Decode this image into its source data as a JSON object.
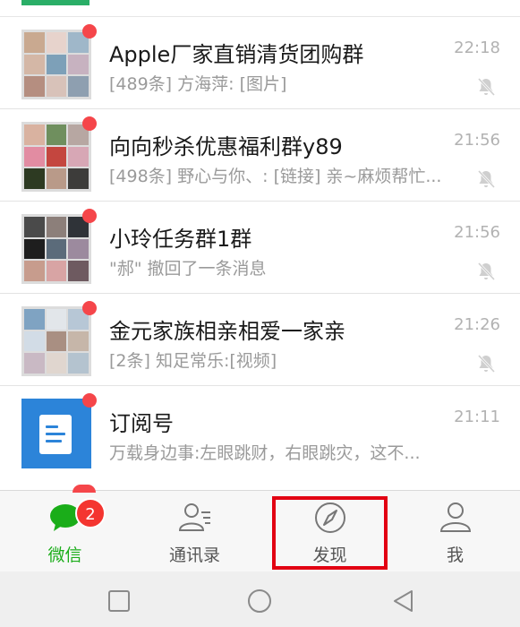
{
  "colors": {
    "accent_green": "#1aad19",
    "unread_red": "#f5464a",
    "badge_red": "#f43530",
    "highlight_red": "#e20012",
    "subscription_blue": "#2c84d9"
  },
  "chats": [
    {
      "name": "Apple厂家直销清货团购群",
      "preview": "[489条] 方海萍: [图片]",
      "time": "22:18",
      "avatar": "group-avatar",
      "muted": true,
      "unread_dot": true
    },
    {
      "name": "向向秒杀优惠福利群y89",
      "preview": "[498条] 野心与你、: [链接] 亲~麻烦帮忙...",
      "time": "21:56",
      "avatar": "group-avatar",
      "muted": true,
      "unread_dot": true
    },
    {
      "name": "小玲任务群1群",
      "preview": "\"郝\" 撤回了一条消息",
      "time": "21:56",
      "avatar": "group-avatar",
      "muted": true,
      "unread_dot": true
    },
    {
      "name": "金元家族相亲相爱一家亲",
      "preview": "[2条] 知足常乐:[视频]",
      "time": "21:26",
      "avatar": "group-avatar",
      "muted": true,
      "unread_dot": true
    },
    {
      "name": "订阅号",
      "preview": "万载身边事:左眼跳财，右眼跳灾，这不...",
      "time": "21:11",
      "avatar": "subscription-icon",
      "muted": false,
      "unread_dot": true
    }
  ],
  "tabbar": {
    "tabs": [
      {
        "label": "微信",
        "icon": "chat-bubble-icon",
        "active": true,
        "badge": "2"
      },
      {
        "label": "通讯录",
        "icon": "contacts-icon",
        "active": false
      },
      {
        "label": "发现",
        "icon": "compass-icon",
        "active": false
      },
      {
        "label": "我",
        "icon": "person-icon",
        "active": false
      }
    ]
  },
  "system_nav": {
    "buttons": [
      "recent-apps-icon",
      "home-icon",
      "back-icon"
    ]
  }
}
